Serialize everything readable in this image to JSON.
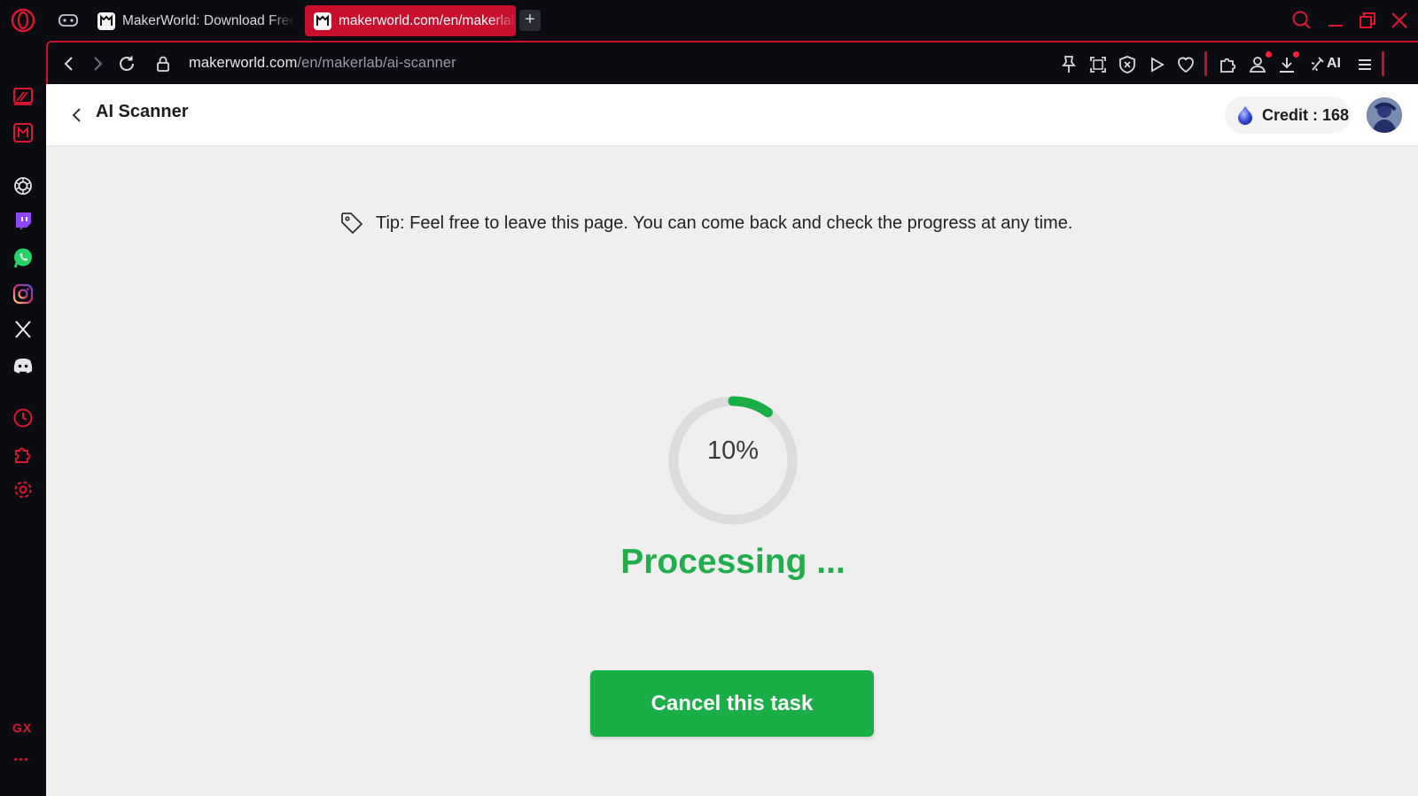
{
  "browser": {
    "tabs": [
      {
        "label": "MakerWorld: Download Free",
        "active": false
      },
      {
        "label": "makerworld.com/en/makerlab/ai-scanner",
        "active": true
      }
    ],
    "new_tab_label": "+",
    "url_host": "makerworld.com",
    "url_path": "/en/makerlab/ai-scanner",
    "toolbar_ai_label": "AI",
    "sidebar_gx_label": "GX",
    "sidebar_more_label": "···",
    "accent_color": "#c8102e"
  },
  "page": {
    "title": "AI Scanner",
    "credit_label": "Credit : 168",
    "tip_text": "Tip: Feel free to leave this page. You can come back and check the progress at any time.",
    "progress_text": "10%",
    "progress_value": 0.1,
    "status_text": "Processing ...",
    "cancel_button_label": "Cancel this task",
    "primary_color": "#1aae46"
  }
}
